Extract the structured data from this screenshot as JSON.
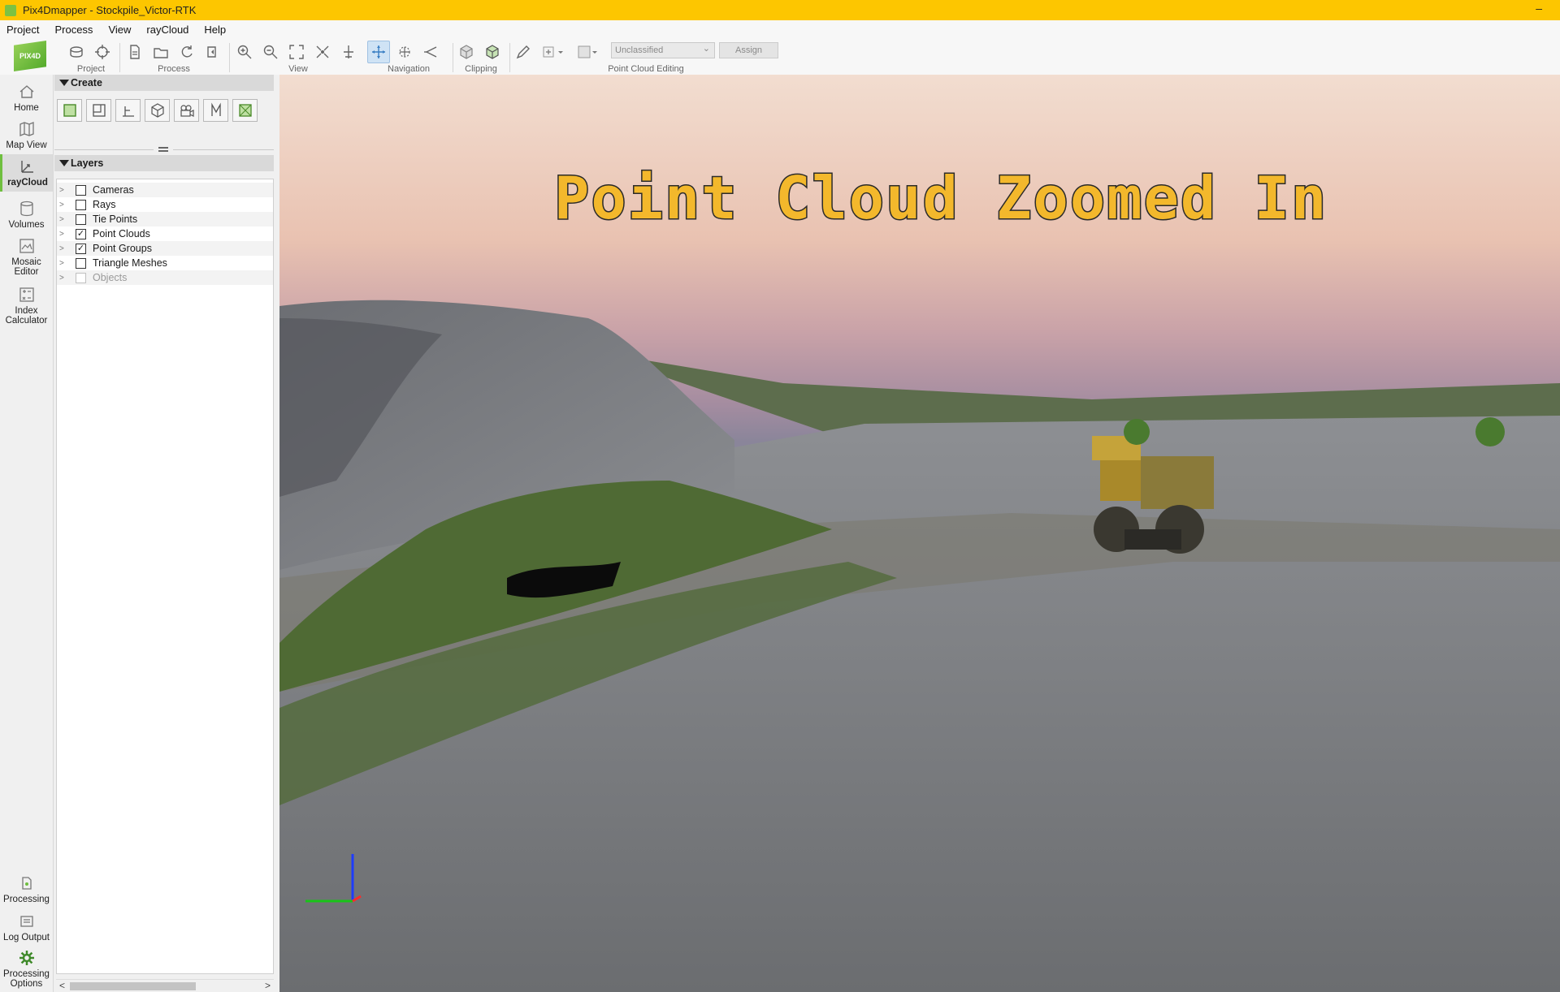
{
  "window": {
    "title": "Pix4Dmapper - Stockpile_Victor-RTK",
    "minimize": "–"
  },
  "menu": [
    "Project",
    "Process",
    "View",
    "rayCloud",
    "Help"
  ],
  "logo_text": "PIX4D",
  "toolbar_groups": {
    "project": "Project",
    "process": "Process",
    "view": "View",
    "navigation": "Navigation",
    "clipping": "Clipping",
    "editing": "Point Cloud Editing"
  },
  "classification": {
    "selected": "Unclassified",
    "assign": "Assign"
  },
  "sidebar": {
    "top": [
      "Home",
      "Map View",
      "rayCloud",
      "Volumes",
      "Mosaic Editor",
      "Index Calculator"
    ],
    "bottom": [
      "Processing",
      "Log Output",
      "Processing Options"
    ],
    "active": "rayCloud"
  },
  "create_panel": {
    "title": "Create"
  },
  "layers_panel": {
    "title": "Layers",
    "items": [
      {
        "label": "Cameras",
        "checked": false,
        "enabled": true
      },
      {
        "label": "Rays",
        "checked": false,
        "enabled": true
      },
      {
        "label": "Tie Points",
        "checked": false,
        "enabled": true
      },
      {
        "label": "Point Clouds",
        "checked": true,
        "enabled": true
      },
      {
        "label": "Point Groups",
        "checked": true,
        "enabled": true
      },
      {
        "label": "Triangle Meshes",
        "checked": false,
        "enabled": true
      },
      {
        "label": "Objects",
        "checked": false,
        "enabled": false
      }
    ]
  },
  "viewport": {
    "overlay_title": "Point Cloud Zoomed In"
  },
  "colors": {
    "title_bar": "#fdc600",
    "accent": "#6fbf3f",
    "overlay_text": "#f3b82c"
  }
}
